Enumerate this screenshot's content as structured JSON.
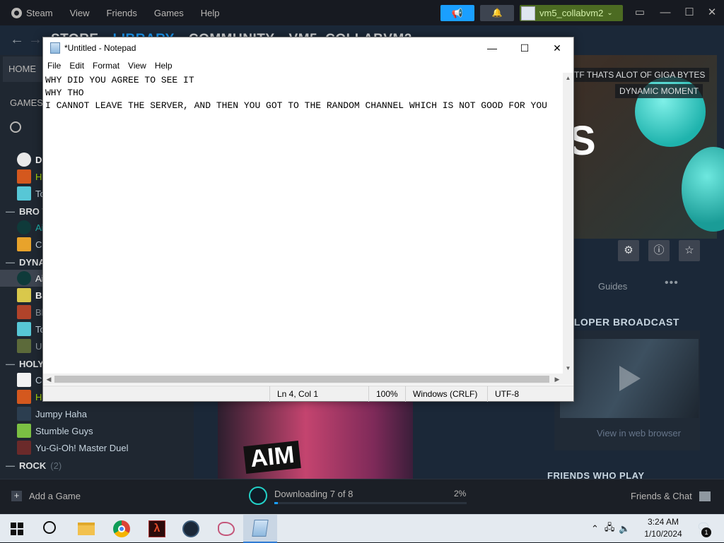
{
  "steam": {
    "menu": [
      "Steam",
      "View",
      "Friends",
      "Games",
      "Help"
    ],
    "username": "vm5_collabvm2",
    "nav_tabs": [
      "STORE",
      "LIBRARY",
      "COMMUNITY",
      "VM5_COLLABVM2"
    ],
    "home_label": "HOME",
    "games_label": "GAMES",
    "sidebar_games_top": [
      "Dr",
      "Ha",
      "To"
    ],
    "categories": [
      {
        "name": "BRO W",
        "count": ""
      },
      {
        "name": "DYNA",
        "count": ""
      },
      {
        "name": "HOLY",
        "count": ""
      },
      {
        "name": "ROCK",
        "count": "(2)"
      }
    ],
    "bro_games": [
      "Ai",
      "Co"
    ],
    "dyna_games": [
      "Ai",
      "Ba",
      "Bl",
      "To",
      "Ur"
    ],
    "holy_games": [
      "Co",
      "Ha",
      "Jumpy Haha",
      "Stumble Guys",
      "Yu-Gi-Oh! Master Duel"
    ],
    "hero_tag_1": "TF THATS ALOT OF GIGA BYTES",
    "hero_tag_2": "DYNAMIC MOMENT",
    "hero_big_letter": "S",
    "guides_label": "Guides",
    "more_label": "•••",
    "broadcast_header": "ELOPER BROADCAST",
    "view_in_browser": "View in web browser",
    "friends_who_play": "FRIENDS WHO PLAY",
    "game_art_logo": "AIM",
    "add_game": "Add a Game",
    "download_text": "Downloading 7 of 8",
    "download_pct": "2%",
    "download_fraction": 0.02,
    "friends_chat": "Friends & Chat"
  },
  "notepad": {
    "title": "*Untitled - Notepad",
    "menu": [
      "File",
      "Edit",
      "Format",
      "View",
      "Help"
    ],
    "content": "WHY DID YOU AGREE TO SEE IT\nWHY THO\nI CANNOT LEAVE THE SERVER, AND THEN YOU GOT TO THE RANDOM CHANNEL WHICH IS NOT GOOD FOR YOU",
    "status": {
      "position": "Ln 4, Col 1",
      "zoom": "100%",
      "line_ending": "Windows (CRLF)",
      "encoding": "UTF-8"
    }
  },
  "taskbar": {
    "time": "3:24 AM",
    "date": "1/10/2024",
    "notification_count": "1"
  },
  "colors": {
    "steam_bg": "#1b2838",
    "steam_accent": "#1a9fff",
    "user_green": "#4c6b22",
    "taskbar_bg": "#e4eaf0"
  }
}
